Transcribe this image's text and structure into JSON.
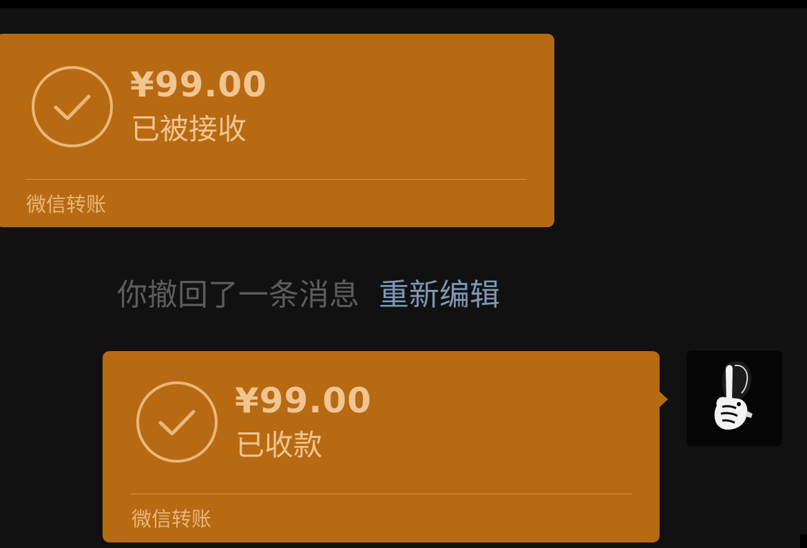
{
  "messages": [
    {
      "direction": "received",
      "amount": "¥99.00",
      "status": "已被接收",
      "footer": "微信转账",
      "icon": "check-circle-icon"
    },
    {
      "direction": "sent",
      "amount": "¥99.00",
      "status": "已收款",
      "footer": "微信转账",
      "icon": "check-circle-icon"
    }
  ],
  "system_notice": {
    "text": "你撤回了一条消息",
    "action_label": "重新编辑"
  },
  "avatar": {
    "icon": "shush-gesture-avatar"
  },
  "colors": {
    "background": "#111111",
    "card": "#b86a12",
    "card_text": "#efc592",
    "notice_text": "#5c5c5c",
    "link": "#7e97b4"
  }
}
